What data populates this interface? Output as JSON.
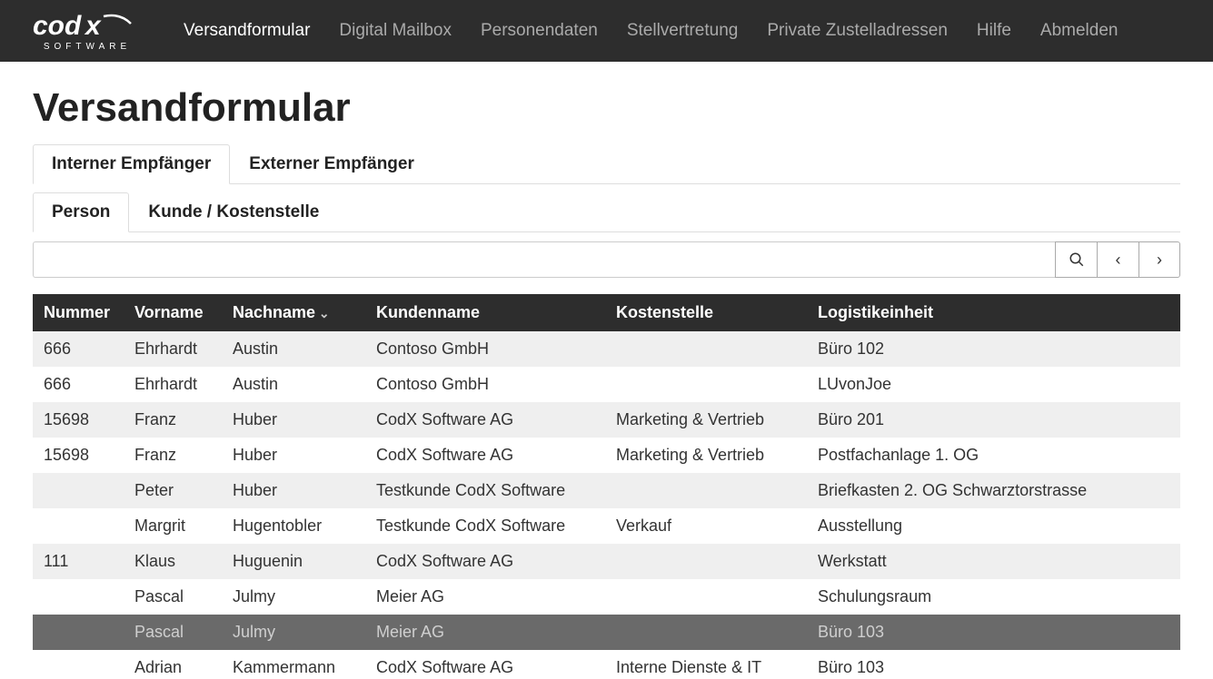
{
  "nav": {
    "items": [
      {
        "label": "Versandformular",
        "active": true
      },
      {
        "label": "Digital Mailbox",
        "active": false
      },
      {
        "label": "Personendaten",
        "active": false
      },
      {
        "label": "Stellvertretung",
        "active": false
      },
      {
        "label": "Private Zustelladressen",
        "active": false
      },
      {
        "label": "Hilfe",
        "active": false
      },
      {
        "label": "Abmelden",
        "active": false
      }
    ],
    "logo_sub": "SOFTWARE"
  },
  "page_title": "Versandformular",
  "tabs_primary": [
    {
      "label": "Interner Empfänger",
      "active": true
    },
    {
      "label": "Externer Empfänger",
      "active": false
    }
  ],
  "tabs_secondary": [
    {
      "label": "Person",
      "active": true
    },
    {
      "label": "Kunde / Kostenstelle",
      "active": false
    }
  ],
  "search": {
    "value": "",
    "placeholder": ""
  },
  "table": {
    "columns": [
      {
        "label": "Nummer",
        "sorted": false
      },
      {
        "label": "Vorname",
        "sorted": false
      },
      {
        "label": "Nachname",
        "sorted": true
      },
      {
        "label": "Kundenname",
        "sorted": false
      },
      {
        "label": "Kostenstelle",
        "sorted": false
      },
      {
        "label": "Logistikeinheit",
        "sorted": false
      }
    ],
    "rows": [
      {
        "nummer": "666",
        "vorname": "Ehrhardt",
        "nachname": "Austin",
        "kunde": "Contoso GmbH",
        "kst": "",
        "lu": "Büro 102",
        "selected": false
      },
      {
        "nummer": "666",
        "vorname": "Ehrhardt",
        "nachname": "Austin",
        "kunde": "Contoso GmbH",
        "kst": "",
        "lu": "LUvonJoe",
        "selected": false
      },
      {
        "nummer": "15698",
        "vorname": "Franz",
        "nachname": "Huber",
        "kunde": "CodX Software AG",
        "kst": "Marketing & Vertrieb",
        "lu": "Büro 201",
        "selected": false
      },
      {
        "nummer": "15698",
        "vorname": "Franz",
        "nachname": "Huber",
        "kunde": "CodX Software AG",
        "kst": "Marketing & Vertrieb",
        "lu": "Postfachanlage 1. OG",
        "selected": false
      },
      {
        "nummer": "",
        "vorname": "Peter",
        "nachname": "Huber",
        "kunde": "Testkunde CodX Software",
        "kst": "",
        "lu": "Briefkasten 2. OG Schwarztorstrasse",
        "selected": false
      },
      {
        "nummer": "",
        "vorname": "Margrit",
        "nachname": "Hugentobler",
        "kunde": "Testkunde CodX Software",
        "kst": "Verkauf",
        "lu": "Ausstellung",
        "selected": false
      },
      {
        "nummer": "111",
        "vorname": "Klaus",
        "nachname": "Huguenin",
        "kunde": "CodX Software AG",
        "kst": "",
        "lu": "Werkstatt",
        "selected": false
      },
      {
        "nummer": "",
        "vorname": "Pascal",
        "nachname": "Julmy",
        "kunde": "Meier AG",
        "kst": "",
        "lu": "Schulungsraum",
        "selected": false
      },
      {
        "nummer": "",
        "vorname": "Pascal",
        "nachname": "Julmy",
        "kunde": "Meier AG",
        "kst": "",
        "lu": "Büro 103",
        "selected": true
      },
      {
        "nummer": "",
        "vorname": "Adrian",
        "nachname": "Kammermann",
        "kunde": "CodX Software AG",
        "kst": "Interne Dienste & IT",
        "lu": "Büro 103",
        "selected": false
      }
    ]
  }
}
